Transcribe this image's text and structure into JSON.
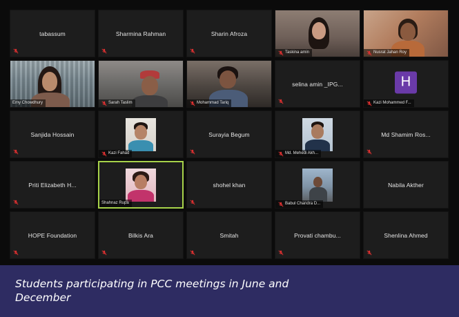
{
  "caption": "Students participating in PCC meetings in June and December",
  "colors": {
    "screen_background": "#0b0b0b",
    "tile_background": "#1d1d1d",
    "active_speaker_border": "#a7d34a",
    "muted_mic": "#e03131",
    "avatar_h": "#6a3aa8",
    "caption_bar": "#2e2c62"
  },
  "icons": {
    "muted_mic": "mic-muted-icon"
  },
  "participants": [
    {
      "name": "tabassum",
      "video": false,
      "muted": true
    },
    {
      "name": "Sharmina Rahman",
      "video": false,
      "muted": true
    },
    {
      "name": "Sharin Afroza",
      "video": false,
      "muted": true
    },
    {
      "name": "Taskina amin",
      "video": true,
      "label": "Taskina amin",
      "muted": true
    },
    {
      "name": "Nusrat Jahan Roy",
      "video": true,
      "label": "Nusrat Jahan Roy",
      "muted": true
    },
    {
      "name": "Emy Chowdhury",
      "video": true,
      "label": "Emy Chowdhury",
      "muted": false
    },
    {
      "name": "Sarah Taslim",
      "video": true,
      "label": "Sarah Taslim",
      "muted": true
    },
    {
      "name": "Mohammad Tariq",
      "video": true,
      "label": "Mohammad Tariq",
      "muted": true
    },
    {
      "name": "selina amin _IPG...",
      "video": false,
      "muted": true
    },
    {
      "name": "Kazi Mohammed F...",
      "video": false,
      "avatar_letter": "H",
      "label": "Kazi Mohammed F...",
      "muted": true
    },
    {
      "name": "Sanjida Hossain",
      "video": false,
      "muted": true
    },
    {
      "name": "Kazi Fahad",
      "video": false,
      "profile_photo": true,
      "label": "Kazi Fahad",
      "muted": true
    },
    {
      "name": "Surayia Begum",
      "video": false,
      "muted": true
    },
    {
      "name": "Md. Mehedi Akh...",
      "video": false,
      "profile_photo": true,
      "label": "Md. Mehedi Akh...",
      "muted": true
    },
    {
      "name": "Md Shamim Ros...",
      "video": false,
      "muted": true
    },
    {
      "name": "Priti Elizabeth H...",
      "video": false,
      "muted": true
    },
    {
      "name": "Shahnaz Rupa",
      "video": false,
      "profile_photo": true,
      "label": "Shahnaz Rupa",
      "muted": false,
      "active_speaker": true
    },
    {
      "name": "shohel khan",
      "video": false,
      "muted": true
    },
    {
      "name": "Babul Chandra D...",
      "video": false,
      "profile_photo": true,
      "label": "Babul Chandra D...",
      "muted": true
    },
    {
      "name": "Nabila Akther",
      "video": false,
      "muted": false
    },
    {
      "name": "HOPE Foundation",
      "video": false,
      "muted": true
    },
    {
      "name": "Bilkis Ara",
      "video": false,
      "muted": true
    },
    {
      "name": "Smitah",
      "video": false,
      "muted": true
    },
    {
      "name": "Provati chambu...",
      "video": false,
      "muted": true
    },
    {
      "name": "Shenlina Ahmed",
      "video": false,
      "muted": true
    }
  ]
}
